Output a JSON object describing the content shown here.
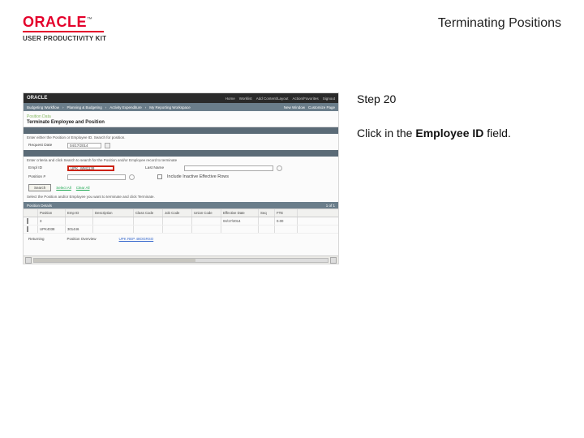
{
  "header": {
    "brand_word": "ORACLE",
    "brand_tm": "™",
    "upk_line": "USER PRODUCTIVITY KIT",
    "doc_title": "Terminating Positions"
  },
  "instruction": {
    "step_label": "Step 20",
    "text_before": "Click in the ",
    "field_name": "Employee ID",
    "text_after": " field."
  },
  "app": {
    "brand": "ORACLE",
    "top_tools": [
      "Home",
      "Worklist",
      "Add Content/Layout",
      "Action/Favorites",
      "Signout"
    ],
    "nav_left": [
      "Budgeting Workflow",
      "Planning & Budgeting",
      "Activity Expenditure",
      "My Reporting Workspace"
    ],
    "nav_right": [
      "New Window",
      "Customize Page"
    ],
    "section_label": "Position Data",
    "page_title": "Terminate Employee and Position",
    "note_text": "Enter either the Position or Employee ID. Search for position.",
    "fields": {
      "run_date_label": "Request Date",
      "run_date_value": "04/17/2014",
      "criteria_hint": "Enter criteria and click Search to search for the Position and/or Employee record to terminate",
      "emp_id_label": "Empl ID",
      "emp_id_value": "UPK_WM1138",
      "last_name_label": "Last Name",
      "position_label": "Position #",
      "team_label": "Include Inactive Effective Rows"
    },
    "links": {
      "select_all": "Select All",
      "clear_all": "Clear All"
    },
    "search_btn": "Search",
    "help_text": "Select the Position and/or Employee you want to terminate and click Terminate.",
    "sect_inner": {
      "label": "Position Details",
      "pager": "1 of 1"
    },
    "grid": {
      "cols": [
        "",
        "Position",
        "Emp ID",
        "Description",
        "Class Code",
        "Job Code",
        "Union Code",
        "Effective Date",
        "Seq",
        "FTE"
      ],
      "row1": [
        "chk",
        "3",
        "",
        "",
        "",
        "",
        "",
        "04/17/2014",
        "",
        "0.00"
      ],
      "row2": [
        "chk_on",
        "UPK4038",
        "301446",
        "",
        "",
        "",
        "",
        "",
        "",
        ""
      ]
    },
    "summary": {
      "ret_label": "Returning",
      "pos_label": "Position Overview",
      "pos_link": "UPK REP 48OGRSO"
    }
  }
}
